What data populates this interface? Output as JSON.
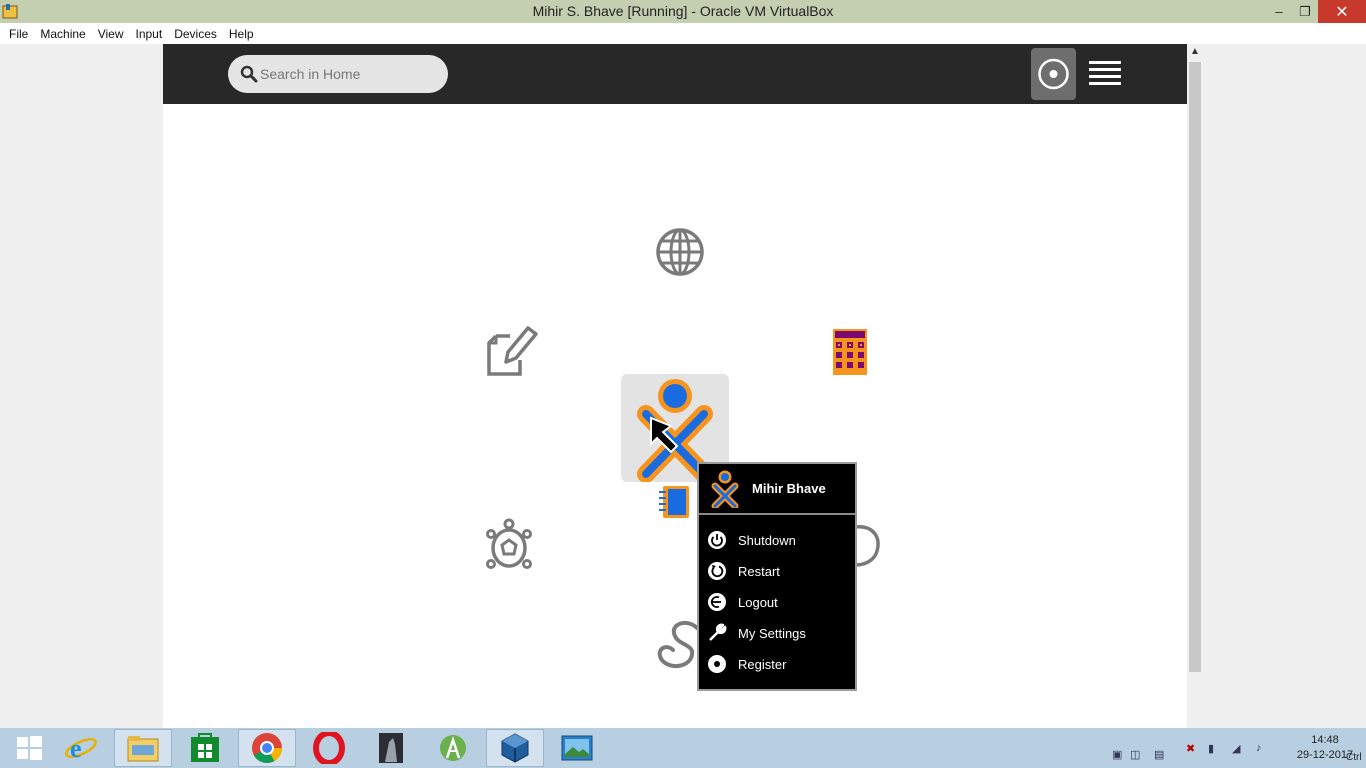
{
  "window": {
    "title": "Mihir S. Bhave [Running] - Oracle VM VirtualBox",
    "min_glyph": "–",
    "max_glyph": "❐",
    "close_glyph": "✕"
  },
  "menubar": {
    "items": [
      "File",
      "Machine",
      "View",
      "Input",
      "Devices",
      "Help"
    ]
  },
  "guest": {
    "search_placeholder": "Search in Home",
    "activities": [
      "globe-icon",
      "write-icon",
      "calculate-icon",
      "xo-icon",
      "journal-icon",
      "turtle-icon",
      "snake-icon",
      "partial-circle-icon"
    ],
    "palette": {
      "user_name": "Mihir Bhave",
      "items": [
        {
          "label": "Shutdown",
          "icon": "power-icon"
        },
        {
          "label": "Restart",
          "icon": "restart-icon"
        },
        {
          "label": "Logout",
          "icon": "logout-icon"
        },
        {
          "label": "My Settings",
          "icon": "wrench-icon"
        },
        {
          "label": "Register",
          "icon": "register-icon"
        }
      ]
    },
    "colors": {
      "xo_stroke": "#f7941d",
      "xo_fill": "#1a6be0",
      "toolbar": "#282828"
    }
  },
  "taskbar": {
    "apps": [
      "windows-start",
      "internet-explorer",
      "file-explorer",
      "store",
      "chrome",
      "opera",
      "game",
      "android-studio",
      "virtualbox",
      "photos"
    ],
    "clock_time": "14:48",
    "clock_date": "29-12-2017",
    "host_key": "Ctrl"
  }
}
